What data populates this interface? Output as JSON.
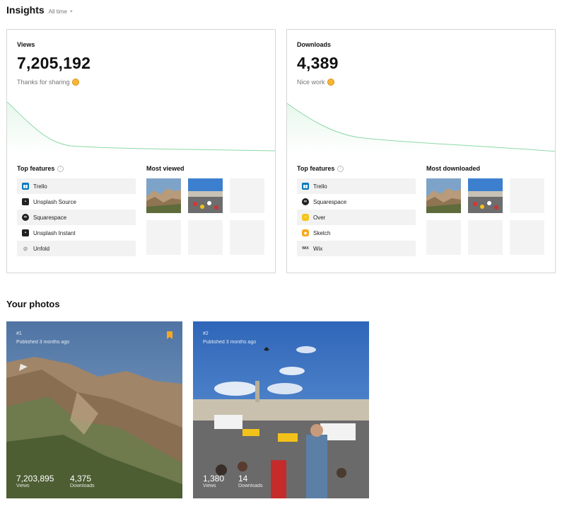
{
  "insights": {
    "title": "Insights",
    "range": "All time"
  },
  "views_card": {
    "label": "Views",
    "value": "7,205,192",
    "note": "Thanks for sharing",
    "top_features_title": "Top features",
    "features": [
      "Trello",
      "Unsplash Source",
      "Squarespace",
      "Unsplash Instant",
      "Unfold"
    ],
    "most_title": "Most viewed"
  },
  "downloads_card": {
    "label": "Downloads",
    "value": "4,389",
    "note": "Nice work",
    "top_features_title": "Top features",
    "features": [
      "Trello",
      "Squarespace",
      "Over",
      "Sketch",
      "Wix"
    ],
    "most_title": "Most downloaded"
  },
  "your_photos": {
    "title": "Your photos",
    "items": [
      {
        "rank": "#1",
        "published": "Published 3 months ago",
        "views": "7,203,895",
        "views_label": "Views",
        "downloads": "4,375",
        "downloads_label": "Downloads"
      },
      {
        "rank": "#2",
        "published": "Published 3 months ago",
        "views": "1,380",
        "views_label": "Views",
        "downloads": "14",
        "downloads_label": "Downloads"
      }
    ]
  },
  "colors": {
    "sparkline": "#8fd9a8",
    "bookmark": "#f5a623"
  }
}
